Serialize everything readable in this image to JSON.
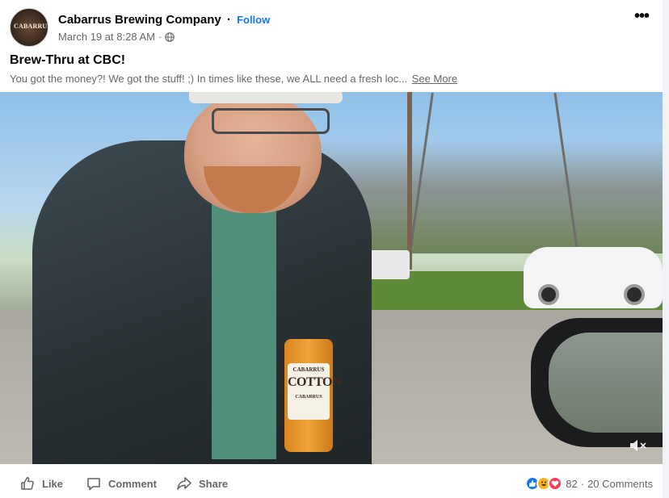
{
  "post": {
    "page_name": "Cabarrus Brewing Company",
    "separator": "·",
    "follow_label": "Follow",
    "timestamp": "March 19 at 8:28 AM",
    "meta_separator": "·",
    "audience_icon": "globe-icon",
    "more_icon": "more-options-icon",
    "more_label": "•••",
    "avatar_text": "CABARRUS",
    "title": "Brew-Thru at CBC!",
    "text": "You got the money?! We got the stuff! ;) In times like these, we ALL need a fresh loc...",
    "see_more_label": "See More"
  },
  "video": {
    "can_brand": "CABARRUS",
    "can_name": "COTTON",
    "can_sub": "CABARRUS",
    "mute_icon": "muted-speaker-icon"
  },
  "actions": {
    "like_label": "Like",
    "comment_label": "Comment",
    "share_label": "Share"
  },
  "stats": {
    "reaction_types": [
      "like",
      "haha",
      "love"
    ],
    "reaction_count": "82",
    "separator": "·",
    "comment_count": "20 Comments"
  },
  "colors": {
    "accent": "#1877f2",
    "secondary_text": "#65676b",
    "like": "#1877f2",
    "haha": "#f7b125",
    "love": "#f33e58"
  }
}
